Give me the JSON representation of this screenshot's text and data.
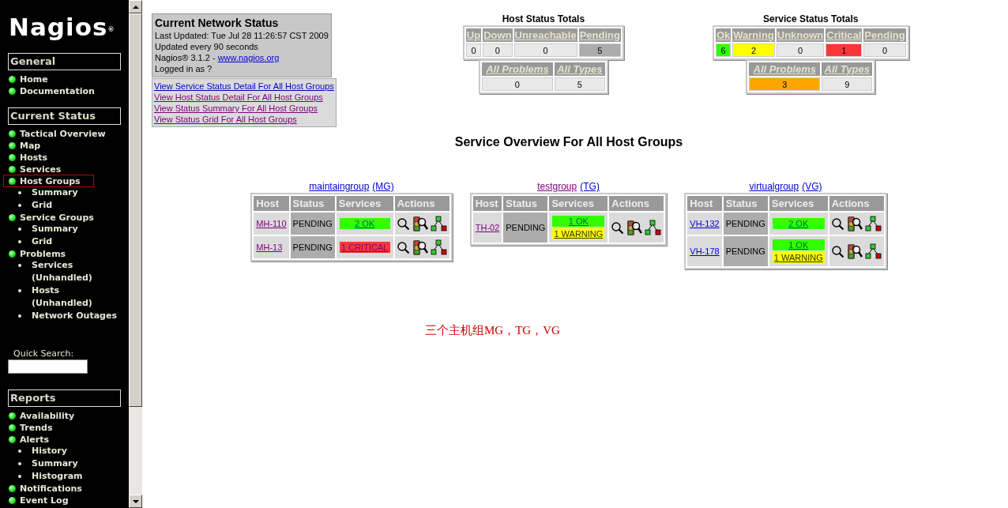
{
  "sidebar": {
    "logo": "Nagios$^{®}$",
    "sections": [
      {
        "title": "General",
        "items": [
          {
            "label": "Home",
            "selected": false
          },
          {
            "label": "Documentation",
            "selected": false
          }
        ]
      },
      {
        "title": "Current Status",
        "items": [
          {
            "label": "Tactical Overview",
            "selected": false
          },
          {
            "label": "Map",
            "selected": false
          },
          {
            "label": "Hosts",
            "selected": false
          },
          {
            "label": "Services",
            "selected": false
          },
          {
            "label": "Host Groups",
            "selected": true,
            "children": [
              {
                "label": "Summary",
                "selected": false
              },
              {
                "label": "Grid",
                "selected": false
              }
            ]
          },
          {
            "label": "Service Groups",
            "selected": false,
            "children": [
              {
                "label": "Summary",
                "selected": false
              },
              {
                "label": "Grid",
                "selected": false
              }
            ]
          },
          {
            "label": "Problems",
            "selected": false,
            "children": [
              {
                "label": "Services (Unhandled)",
                "selected": false
              },
              {
                "label": "Hosts (Unhandled)",
                "selected": false
              },
              {
                "label": "Network Outages",
                "selected": false
              }
            ]
          }
        ]
      },
      {
        "title": "Reports",
        "items": [
          {
            "label": "Availability",
            "selected": false
          },
          {
            "label": "Trends",
            "selected": false
          },
          {
            "label": "Alerts",
            "selected": false,
            "children": [
              {
                "label": "History",
                "selected": false
              },
              {
                "label": "Summary",
                "selected": false
              },
              {
                "label": "Histogram",
                "selected": false
              }
            ]
          },
          {
            "label": "Notifications",
            "selected": false
          },
          {
            "label": "Event Log",
            "selected": false
          }
        ]
      }
    ],
    "quick_search": {
      "label": "Quick Search:"
    }
  },
  "network_status": {
    "title": "Current Network Status",
    "lines": [
      "Last Updated: Tue Jul 28 11:26:57 CST 2009",
      "Updated every 90 seconds"
    ],
    "version": "Nagios® 3.1.2 -",
    "website": "www.nagios.org",
    "login": "Logged in as ?",
    "links": [
      {
        "label": "View Service Status Detail For All Host Groups",
        "visited": false
      },
      {
        "label": "View Host Status Detail For All Host Groups",
        "visited": true
      },
      {
        "label": "View Status Summary For All Host Groups",
        "visited": true
      },
      {
        "label": "View Status Grid For All Host Groups",
        "visited": true
      }
    ]
  },
  "host_totals": {
    "title": "Host Status Totals",
    "columns": [
      "Up",
      "Down",
      "Unreachable",
      "Pending"
    ],
    "values": [
      {
        "text": "0",
        "kind": "none"
      },
      {
        "text": "0",
        "kind": "none"
      },
      {
        "text": "0",
        "kind": "none"
      },
      {
        "text": "5",
        "kind": "pending"
      }
    ],
    "summary_columns": [
      "All Problems",
      "All Types"
    ],
    "summary_values": [
      {
        "text": "0",
        "kind": "none"
      },
      {
        "text": "5",
        "kind": "none"
      }
    ]
  },
  "service_totals": {
    "title": "Service Status Totals",
    "columns": [
      "Ok",
      "Warning",
      "Unknown",
      "Critical",
      "Pending"
    ],
    "values": [
      {
        "text": "6",
        "kind": "ok"
      },
      {
        "text": "2",
        "kind": "warning"
      },
      {
        "text": "0",
        "kind": "none"
      },
      {
        "text": "1",
        "kind": "critical"
      },
      {
        "text": "0",
        "kind": "none"
      }
    ],
    "summary_columns": [
      "All Problems",
      "All Types"
    ],
    "summary_values": [
      {
        "text": "3",
        "kind": "problems"
      },
      {
        "text": "9",
        "kind": "none"
      }
    ]
  },
  "overview_title": "Service Overview For All Host Groups",
  "groups": [
    {
      "name": "maintaingroup",
      "name_visited": false,
      "alias": "(MG)",
      "columns": [
        "Host",
        "Status",
        "Services",
        "Actions"
      ],
      "rows": [
        {
          "host": "MH-110",
          "visited": true,
          "status": "PENDING",
          "services": [
            {
              "label": "2 OK",
              "kind": "ok"
            }
          ]
        },
        {
          "host": "MH-13",
          "visited": true,
          "status": "PENDING",
          "services": [
            {
              "label": "1 CRITICAL",
              "kind": "critical"
            }
          ]
        }
      ]
    },
    {
      "name": "testgroup",
      "name_visited": true,
      "alias": "(TG)",
      "columns": [
        "Host",
        "Status",
        "Services",
        "Actions"
      ],
      "rows": [
        {
          "host": "TH-02",
          "visited": true,
          "status": "PENDING",
          "services": [
            {
              "label": "1 OK",
              "kind": "ok"
            },
            {
              "label": "1 WARNING",
              "kind": "warning"
            }
          ]
        }
      ]
    },
    {
      "name": "virtualgroup",
      "name_visited": false,
      "alias": "(VG)",
      "columns": [
        "Host",
        "Status",
        "Services",
        "Actions"
      ],
      "rows": [
        {
          "host": "VH-132",
          "visited": false,
          "status": "PENDING",
          "services": [
            {
              "label": "2 OK",
              "kind": "ok"
            }
          ]
        },
        {
          "host": "VH-178",
          "visited": false,
          "status": "PENDING",
          "services": [
            {
              "label": "1 OK",
              "kind": "ok"
            },
            {
              "label": "1 WARNING",
              "kind": "warning"
            }
          ]
        }
      ]
    }
  ],
  "annotation": "三个主机组MG，TG，VG"
}
